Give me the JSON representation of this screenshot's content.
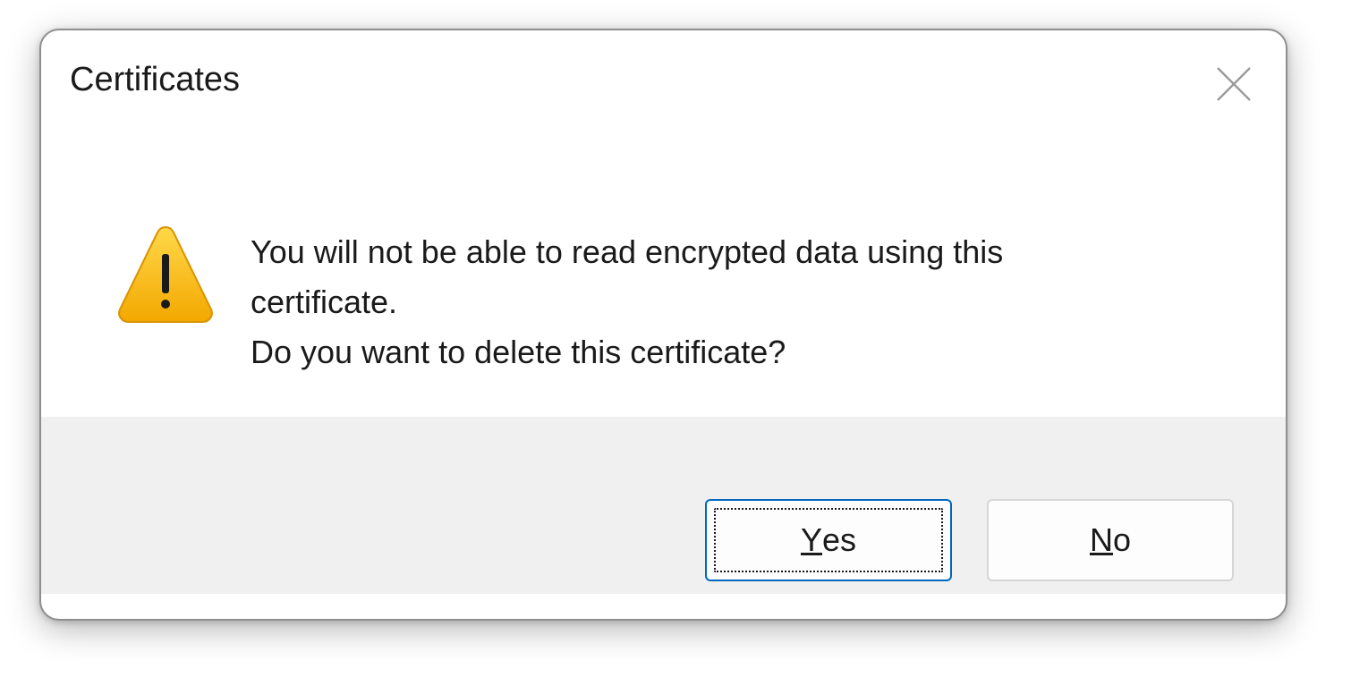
{
  "dialog": {
    "title": "Certificates",
    "message_lines": [
      "You will not be able to read encrypted data using this",
      "certificate.",
      "Do you want to delete this certificate?"
    ],
    "icon": "warning-icon",
    "close_icon": "close-icon"
  },
  "buttons": {
    "yes": {
      "mnemonic": "Y",
      "rest": "es"
    },
    "no": {
      "mnemonic": "N",
      "rest": "o"
    }
  },
  "colors": {
    "accent": "#0067c0",
    "warning": "#f7b500",
    "footer_bg": "#f0f0f0"
  }
}
